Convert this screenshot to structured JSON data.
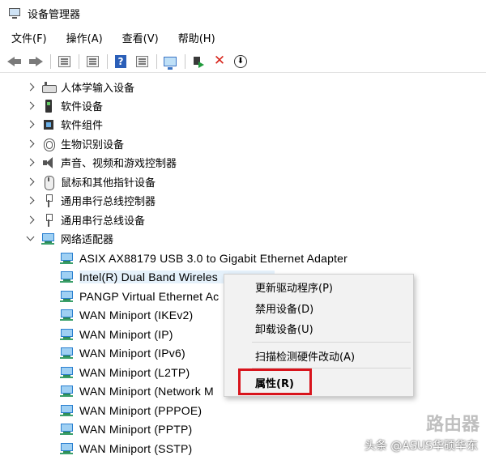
{
  "window": {
    "title": "设备管理器"
  },
  "menu": [
    "文件(F)",
    "操作(A)",
    "查看(V)",
    "帮助(H)"
  ],
  "toolbar": {
    "buttons": [
      "back-icon",
      "forward-icon",
      "properties-icon",
      "list-icon",
      "help-icon",
      "view-icon",
      "monitor-icon",
      "enable-device-icon",
      "uninstall-icon",
      "update-icon"
    ]
  },
  "tree": {
    "categories": [
      {
        "label": "人体学输入设备",
        "icon": "hid-icon",
        "expanded": false
      },
      {
        "label": "软件设备",
        "icon": "software-device-icon",
        "expanded": false
      },
      {
        "label": "软件组件",
        "icon": "software-component-icon",
        "expanded": false
      },
      {
        "label": "生物识别设备",
        "icon": "fingerprint-icon",
        "expanded": false
      },
      {
        "label": "声音、视频和游戏控制器",
        "icon": "speaker-icon",
        "expanded": false
      },
      {
        "label": "鼠标和其他指针设备",
        "icon": "mouse-icon",
        "expanded": false
      },
      {
        "label": "通用串行总线控制器",
        "icon": "usb-icon",
        "expanded": false
      },
      {
        "label": "通用串行总线设备",
        "icon": "usb-icon",
        "expanded": false
      },
      {
        "label": "网络适配器",
        "icon": "network-icon",
        "expanded": true
      }
    ],
    "network_devices": [
      {
        "label": "ASIX AX88179 USB 3.0 to Gigabit Ethernet Adapter"
      },
      {
        "label": "Intel(R) Dual Band Wireles",
        "selected": true
      },
      {
        "label": "PANGP Virtual Ethernet Ac"
      },
      {
        "label": "WAN Miniport (IKEv2)"
      },
      {
        "label": "WAN Miniport (IP)"
      },
      {
        "label": "WAN Miniport (IPv6)"
      },
      {
        "label": "WAN Miniport (L2TP)"
      },
      {
        "label": "WAN Miniport (Network M"
      },
      {
        "label": "WAN Miniport (PPPOE)"
      },
      {
        "label": "WAN Miniport (PPTP)"
      },
      {
        "label": "WAN Miniport (SSTP)"
      }
    ]
  },
  "context_menu": {
    "items": [
      "更新驱动程序(P)",
      "禁用设备(D)",
      "卸载设备(U)",
      "扫描检测硬件改动(A)",
      "属性(R)"
    ],
    "highlight_color": "#d8141c"
  },
  "watermark": {
    "text": "头条 @ASUS华硕华东",
    "logo": "路由器"
  }
}
